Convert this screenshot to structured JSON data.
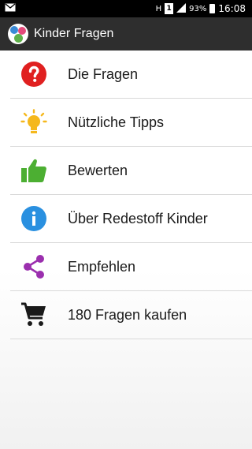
{
  "status_bar": {
    "battery_percent": "93%",
    "time": "16:08",
    "sim_label": "1",
    "network_label": "H"
  },
  "app_bar": {
    "title": "Kinder Fragen"
  },
  "menu": {
    "items": [
      {
        "label": "Die Fragen",
        "icon": "help-icon",
        "color": "#e02020"
      },
      {
        "label": "Nützliche Tipps",
        "icon": "lightbulb-icon",
        "color": "#f5b81c"
      },
      {
        "label": "Bewerten",
        "icon": "thumbs-up-icon",
        "color": "#4caf32"
      },
      {
        "label": "Über Redestoff Kinder",
        "icon": "info-icon",
        "color": "#2a90e0"
      },
      {
        "label": "Empfehlen",
        "icon": "share-icon",
        "color": "#9b2fae"
      },
      {
        "label": "180 Fragen kaufen",
        "icon": "cart-icon",
        "color": "#1a1a1a"
      }
    ]
  }
}
